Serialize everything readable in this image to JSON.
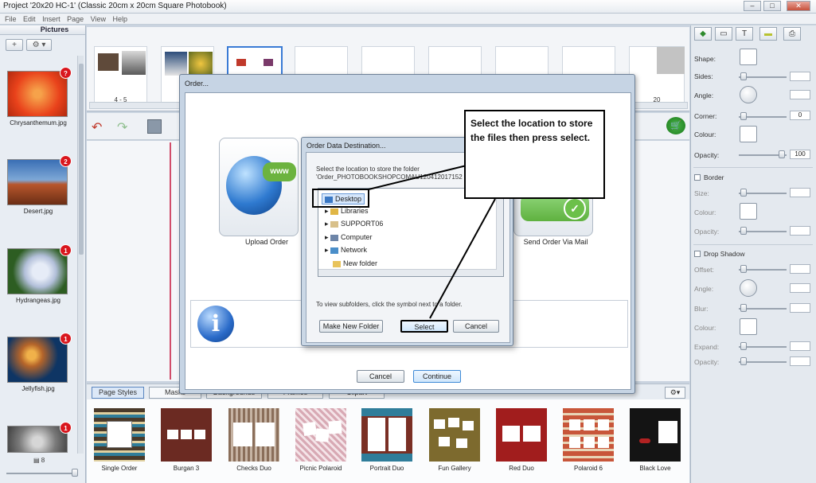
{
  "window": {
    "title": "Project '20x20 HC-1' (Classic 20cm x 20cm Square Photobook)",
    "controls": [
      "–",
      "□",
      "✕"
    ]
  },
  "menu": [
    "File",
    "Edit",
    "Insert",
    "Page",
    "View",
    "Help"
  ],
  "pictures_panel": {
    "header": "Pictures",
    "add_label": "+",
    "settings_label": "⚙ ▾",
    "items": [
      {
        "name": "Chrysanthemum.jpg",
        "badge": "?",
        "color_a": "#e9421b",
        "color_b": "#f6a24a"
      },
      {
        "name": "Desert.jpg",
        "badge": "2",
        "color_a": "#b8562c",
        "color_b": "#3a6fb5"
      },
      {
        "name": "Hydrangeas.jpg",
        "badge": "1",
        "color_a": "#2d5d22",
        "color_b": "#dde3f0"
      },
      {
        "name": "Jellyfish.jpg",
        "badge": "1",
        "color_a": "#0e3564",
        "color_b": "#e09b35"
      },
      {
        "name": "",
        "badge": "1",
        "color_a": "#7a7a7a",
        "color_b": "#d6d6d6"
      }
    ],
    "count": "8"
  },
  "page_strip": {
    "spreads": [
      {
        "label": "4 - 5"
      },
      {
        "label": ""
      },
      {
        "label": "- -"
      },
      {
        "label": ""
      },
      {
        "label": ""
      },
      {
        "label": ""
      },
      {
        "label": ""
      },
      {
        "label": ""
      },
      {
        "label": "20"
      }
    ]
  },
  "bottom_tabs": [
    "Page Styles",
    "Masks",
    "Backgrounds",
    "Frames",
    "Clipart"
  ],
  "page_styles": [
    {
      "label": "Single Order",
      "bg": "#4a3a2a"
    },
    {
      "label": "Burgan 3",
      "bg": "#6b2a22"
    },
    {
      "label": "Checks Duo",
      "bg": "#8a6e5a"
    },
    {
      "label": "Picnic Polaroid",
      "bg": "#d8a9b4"
    },
    {
      "label": "Portrait Duo",
      "bg": "#7a2f24"
    },
    {
      "label": "Fun Gallery",
      "bg": "#7d6a2e"
    },
    {
      "label": "Red Duo",
      "bg": "#a11d1d"
    },
    {
      "label": "Polaroid 6",
      "bg": "#c8563a"
    },
    {
      "label": "Black Love",
      "bg": "#141414"
    }
  ],
  "right_panel": {
    "tabs": [
      "◆",
      "▭",
      "T",
      "▬",
      "⎙"
    ],
    "shape_label": "Shape:",
    "sides_label": "Sides:",
    "angle_label": "Angle:",
    "corner_label": "Corner:",
    "corner_value": "0",
    "colour_label": "Colour:",
    "opacity_label": "Opacity:",
    "opacity_value": "100",
    "border_label": "Border",
    "border_size_label": "Size:",
    "border_colour_label": "Colour:",
    "border_opacity_label": "Opacity:",
    "shadow_label": "Drop Shadow",
    "offset_label": "Offset:",
    "shadow_angle_label": "Angle:",
    "blur_label": "Blur:",
    "shadow_colour_label": "Colour:",
    "expand_label": "Expand:",
    "shadow_opacity_label": "Opacity:"
  },
  "order_dialog": {
    "title": "Order...",
    "upload_label": "Upload Order",
    "mail_label": "Send Order Via Mail",
    "cancel_label": "Cancel",
    "continue_label": "Continue"
  },
  "dest_dialog": {
    "title": "Order Data Destination...",
    "instruction": "Select the location to store the folder 'Order_PHOTOBOOKSHOPCOMAU120412017152",
    "tree": [
      "Desktop",
      "Libraries",
      "SUPPORT06",
      "Computer",
      "Network",
      "New folder"
    ],
    "hint": "To view subfolders, click the symbol next to a folder.",
    "make_folder_label": "Make New Folder",
    "select_label": "Select",
    "cancel_label": "Cancel"
  },
  "callout": {
    "text": "Select the location to store the files then press select."
  }
}
